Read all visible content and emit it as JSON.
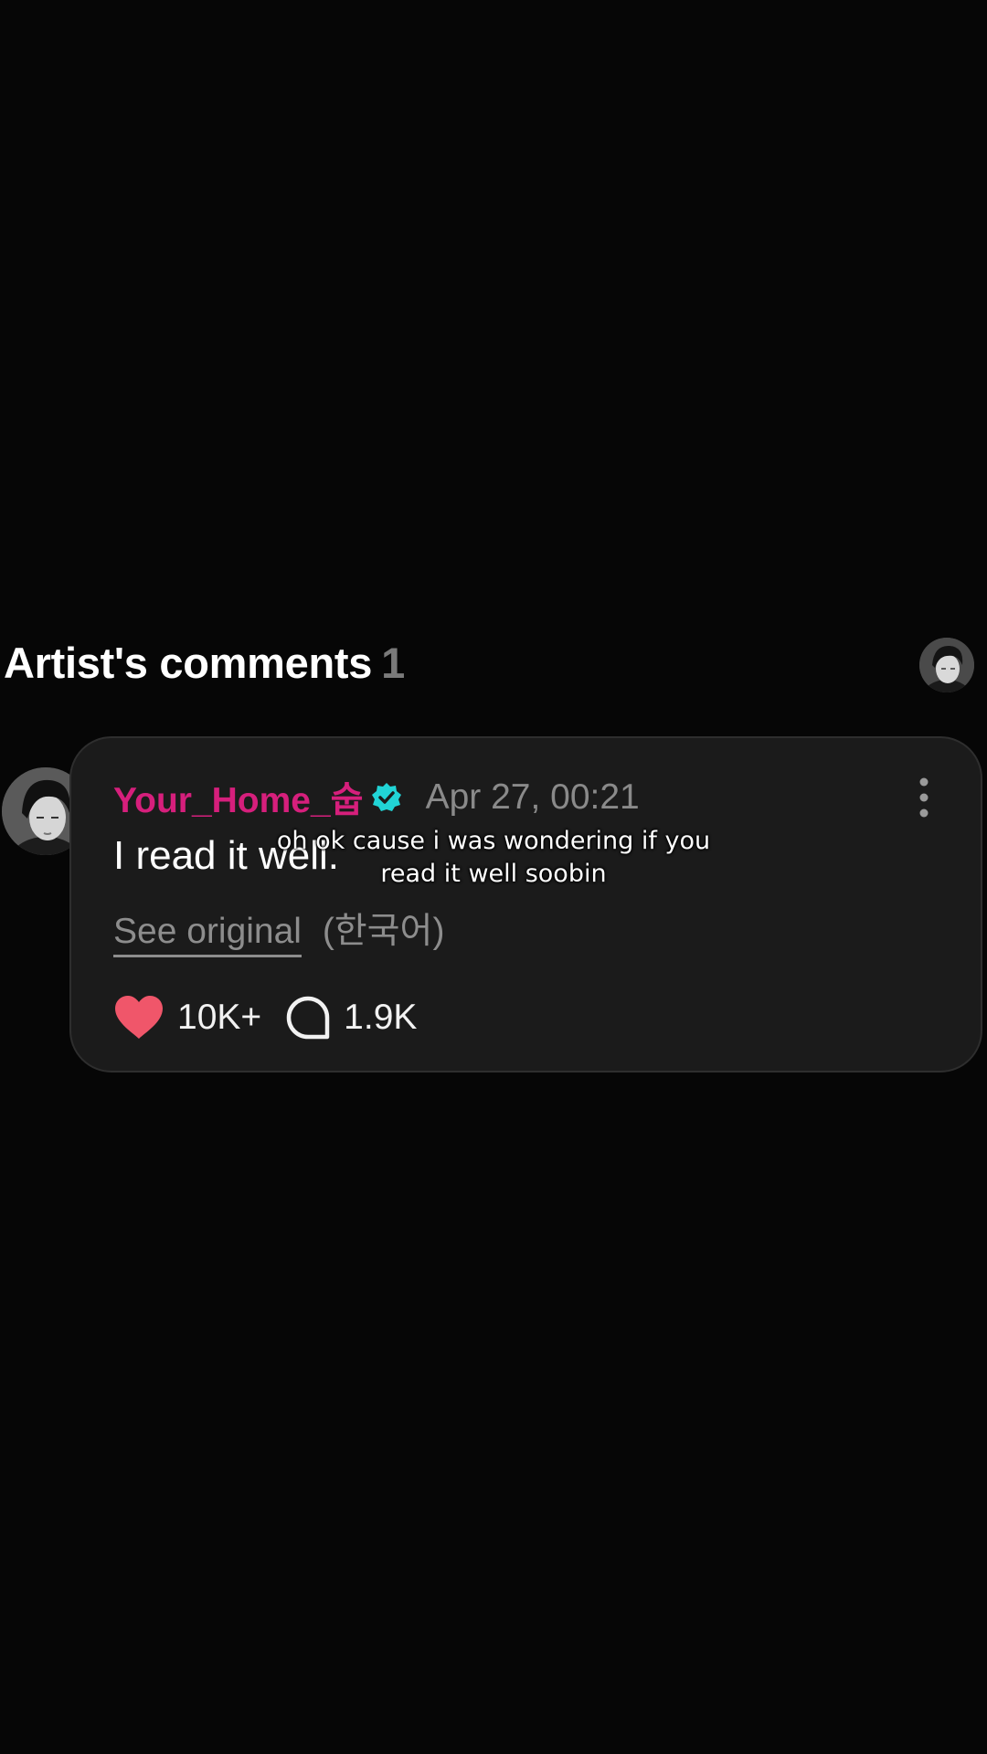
{
  "section": {
    "title": "Artist's comments",
    "count": "1"
  },
  "comment": {
    "username": "Your_Home_숩",
    "timestamp": "Apr 27, 00:21",
    "text": "I read it well.",
    "see_original_label": "See original",
    "original_language": "(한국어)",
    "like_count": "10K+",
    "reply_count": "1.9K"
  },
  "caption": {
    "text": "oh ok cause i was wondering if you read it well soobin"
  },
  "icons": {
    "verified": "verified-badge-icon",
    "more": "more-vertical-icon",
    "like": "heart-icon",
    "reply": "chat-bubble-icon"
  },
  "colors": {
    "background": "#060606",
    "card": "#1b1b1b",
    "username": "#d61f7c",
    "verified": "#21d4d6",
    "heart": "#f0566a",
    "muted": "#8a8a8a"
  }
}
